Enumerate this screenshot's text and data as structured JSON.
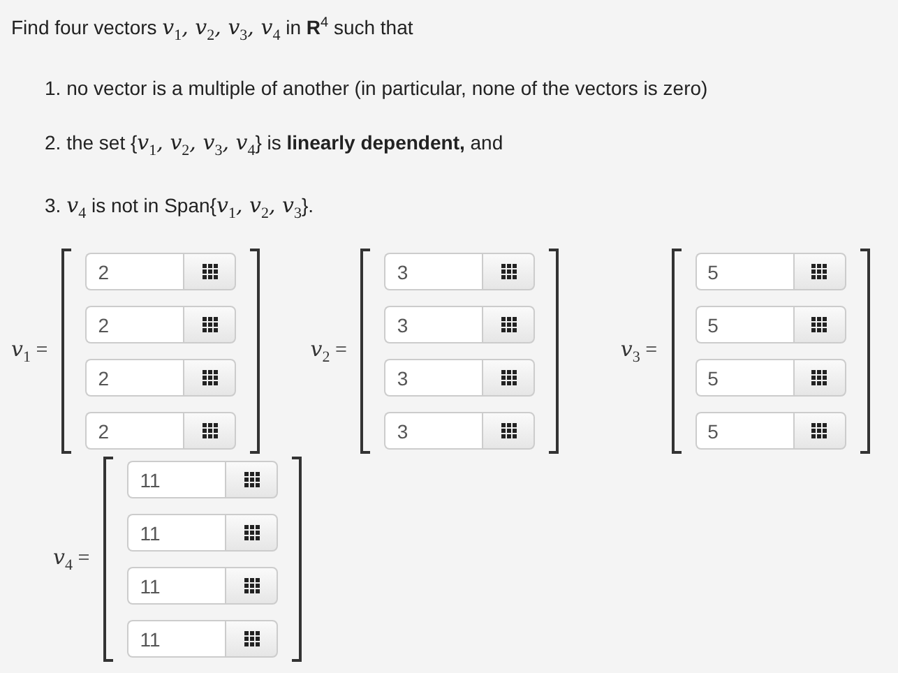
{
  "intro": "Find four vectors *v*$_{1}$*, v*$_{2}$*, v*$_{3}$*, v*$_{4}$ in **R**$^{4}$ such that",
  "conditions": [
    "1. no vector is a multiple of another (in particular, none of the vectors is zero)",
    "2. the set {*v*$_{1}$*, v*$_{2}$*, v*$_{3}$*, v*$_{4}$} is **linearly dependent,** and",
    "3. *v*$_{4}$ is not in Span{*v*$_{1}$*, v*$_{2}$*, v*$_{3}$}."
  ],
  "vectors": [
    {
      "label": "*v*$_{1}$ =",
      "entries": [
        "2",
        "2",
        "2",
        "2"
      ]
    },
    {
      "label": "*v*$_{2}$ =",
      "entries": [
        "3",
        "3",
        "3",
        "3"
      ]
    },
    {
      "label": "*v*$_{3}$ =",
      "entries": [
        "5",
        "5",
        "5",
        "5"
      ]
    },
    {
      "label": "*v*$_{4}$ =",
      "entries": [
        "11",
        "11",
        "11",
        "11"
      ]
    }
  ]
}
